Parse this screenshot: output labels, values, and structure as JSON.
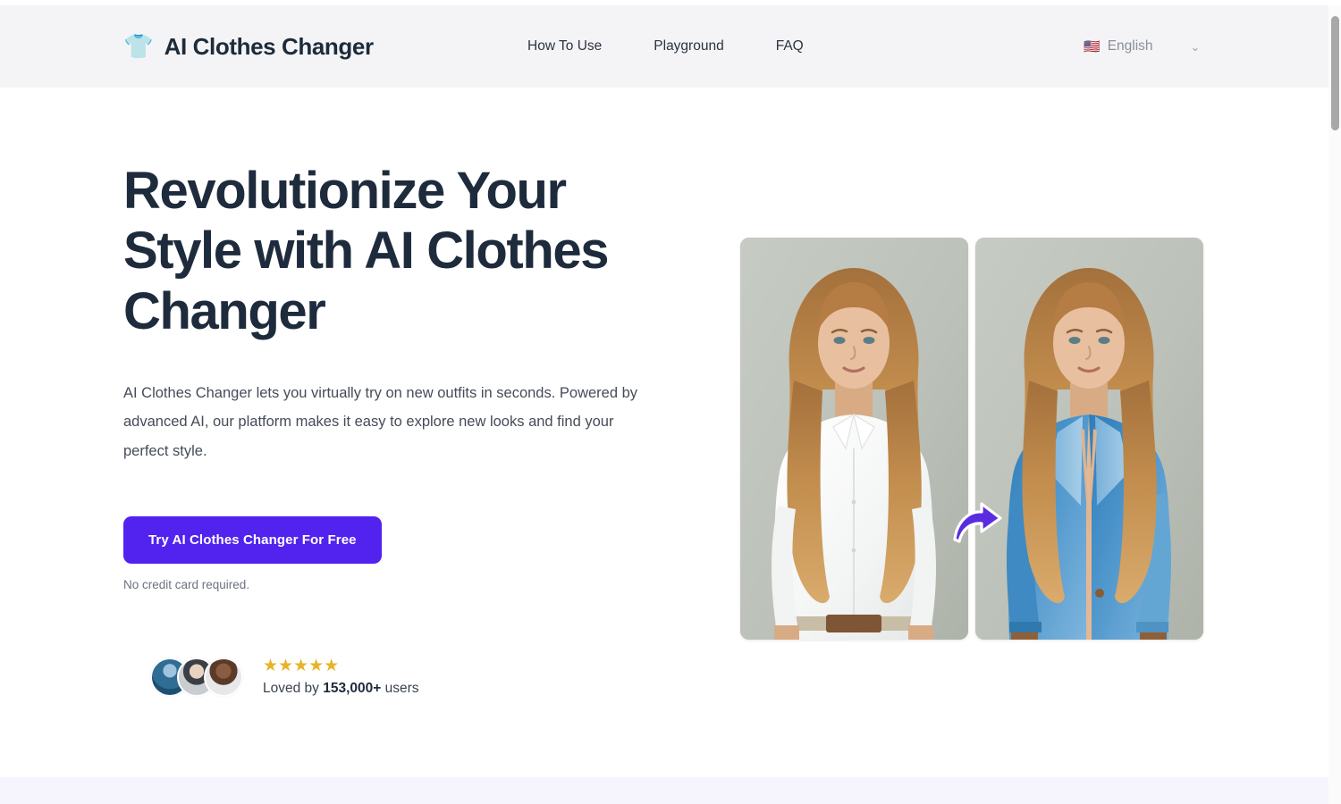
{
  "browser": {
    "scrollbar": "vertical-scrollbar"
  },
  "header": {
    "brand": {
      "icon": "tshirt-icon",
      "icon_glyph": "👕",
      "name": "AI Clothes Changer"
    },
    "nav": [
      {
        "label": "How To Use"
      },
      {
        "label": "Playground"
      },
      {
        "label": "FAQ"
      }
    ],
    "language": {
      "flag": "🇺🇸",
      "label": "English",
      "caret": "⌄"
    },
    "background_color": "#f4f4f6"
  },
  "hero": {
    "title": "Revolutionize Your Style with AI Clothes Changer",
    "subtitle": "AI Clothes Changer lets you virtually try on new outfits in seconds. Powered by advanced AI, our platform makes it easy to explore new looks and find your perfect style.",
    "cta_label": "Try AI Clothes Changer For Free",
    "cta_color": "#5223ee",
    "cta_note": "No credit card required.",
    "social_proof": {
      "avatars": [
        "avatar-1",
        "avatar-2",
        "avatar-3"
      ],
      "stars": "★★★★★",
      "star_count": 5,
      "star_color": "#e7b429",
      "loved_prefix": "Loved by ",
      "loved_count": "153,000+",
      "loved_suffix": " users"
    },
    "visual": {
      "before_alt": "Woman wearing a white button-up shirt",
      "after_alt": "Woman wearing a blue blazer",
      "arrow": "swap-arrow-icon",
      "arrow_color": "#5a2ce0"
    }
  }
}
